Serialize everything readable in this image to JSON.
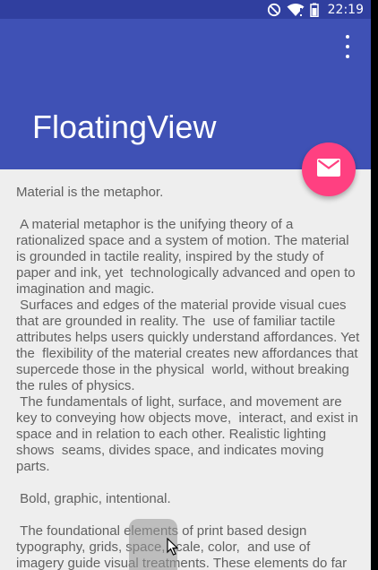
{
  "status_bar": {
    "time": "22:19",
    "icons": [
      "do-not-disturb-icon",
      "wifi-icon",
      "battery-icon"
    ]
  },
  "app_bar": {
    "title": "FloatingView",
    "overflow_icon": "more-vert-icon"
  },
  "fab": {
    "icon": "mail-icon",
    "color": "#ff4081"
  },
  "content": {
    "paragraphs": [
      "Material is the metaphor.",
      "",
      " A material metaphor is the unifying theory of a rationalized space and a system of motion. The material is grounded in tactile reality, inspired by the study of paper and ink, yet  technologically advanced and open to imagination and magic.",
      " Surfaces and edges of the material provide visual cues that are grounded in reality. The  use of familiar tactile attributes helps users quickly understand affordances. Yet the  flexibility of the material creates new affordances that supercede those in the physical  world, without breaking the rules of physics.",
      " The fundamentals of light, surface, and movement are key to conveying how objects move,  interact, and exist in space and in relation to each other. Realistic lighting shows  seams, divides space, and indicates moving parts.",
      "",
      " Bold, graphic, intentional.",
      "",
      " The foundational elements of print based design typography, grids, space, scale, color,  and use of imagery guide visual treatments. These elements do far"
    ]
  },
  "colors": {
    "status_bar": "#303f9f",
    "app_bar": "#3f51b5",
    "accent": "#ff4081",
    "background": "#eeeeee",
    "body_text": "#616161"
  }
}
